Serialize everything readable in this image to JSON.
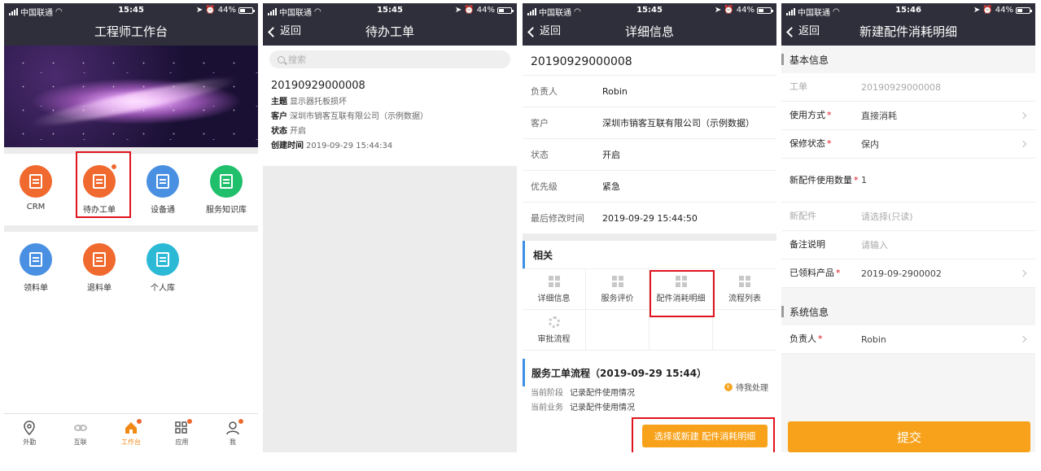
{
  "status_bar": {
    "carrier": "中国联通",
    "battery": "44%",
    "battery_level": 0.44,
    "times": [
      "15:45",
      "15:45",
      "15:45",
      "15:46"
    ]
  },
  "screen1": {
    "title": "工程师工作台",
    "apps_row1": [
      {
        "label": "CRM",
        "color": "#f0692e",
        "icon": "pie-chart-icon"
      },
      {
        "label": "待办工单",
        "color": "#f0692e",
        "icon": "todo-list-icon",
        "badge": true
      },
      {
        "label": "设备通",
        "color": "#4a90e2",
        "icon": "device-icon"
      },
      {
        "label": "服务知识库",
        "color": "#1fbf6c",
        "icon": "book-icon"
      }
    ],
    "apps_row2": [
      {
        "label": "领料单",
        "color": "#4a90e2",
        "icon": "clipboard-icon"
      },
      {
        "label": "退料单",
        "color": "#f0692e",
        "icon": "return-icon"
      },
      {
        "label": "个人库",
        "color": "#2cb9d6",
        "icon": "briefcase-icon"
      }
    ],
    "tabs": [
      {
        "label": "外勤",
        "icon": "location-icon"
      },
      {
        "label": "互联",
        "icon": "link-icon"
      },
      {
        "label": "工作台",
        "icon": "home-icon",
        "active": true,
        "badge": true
      },
      {
        "label": "应用",
        "icon": "apps-icon",
        "badge": true
      },
      {
        "label": "我",
        "icon": "person-icon",
        "badge": true
      }
    ]
  },
  "screen2": {
    "back": "返回",
    "title": "待办工单",
    "search_placeholder": "搜索",
    "order": {
      "number": "20190929000008",
      "subject_label": "主题",
      "subject": "显示器托板损坏",
      "customer_label": "客户",
      "customer": "深圳市销客互联有限公司（示例数据）",
      "status_label": "状态",
      "status": "开启",
      "created_label": "创建时间",
      "created": "2019-09-29 15:44:34"
    }
  },
  "screen3": {
    "back": "返回",
    "title": "详细信息",
    "number": "20190929000008",
    "rows": [
      {
        "label": "负责人",
        "value": "Robin"
      },
      {
        "label": "客户",
        "value": "深圳市销客互联有限公司（示例数据）"
      },
      {
        "label": "状态",
        "value": "开启"
      },
      {
        "label": "优先级",
        "value": "紧急"
      },
      {
        "label": "最后修改时间",
        "value": "2019-09-29 15:44:50"
      }
    ],
    "related_title": "相关",
    "related": [
      {
        "label": "详细信息",
        "icon": "grid-icon"
      },
      {
        "label": "服务评价",
        "icon": "grid-icon"
      },
      {
        "label": "配件消耗明细",
        "icon": "grid-icon"
      },
      {
        "label": "流程列表",
        "icon": "grid-icon"
      },
      {
        "label": "审批流程",
        "icon": "gear-icon"
      }
    ],
    "flow_title": "服务工单流程（2019-09-29 15:44）",
    "flow_status": "待我处理",
    "stage_label": "当前阶段",
    "stage_value": "记录配件使用情况",
    "business_label": "当前业务",
    "business_value": "记录配件使用情况",
    "action": "选择或新建 配件消耗明细"
  },
  "screen4": {
    "back": "返回",
    "title": "新建配件消耗明细",
    "basic_title": "基本信息",
    "fields": [
      {
        "label": "工单",
        "value": "20190929000008",
        "required": false,
        "readonly": true,
        "chevron": false
      },
      {
        "label": "使用方式",
        "value": "直接消耗",
        "required": true,
        "readonly": false,
        "chevron": true
      },
      {
        "label": "保修状态",
        "value": "保内",
        "required": true,
        "readonly": false,
        "chevron": true
      },
      {
        "label": "新配件使用数量",
        "value": "1",
        "required": true,
        "readonly": false,
        "chevron": false,
        "tall": true
      },
      {
        "label": "新配件",
        "value": "请选择(只读)",
        "required": false,
        "readonly": true,
        "chevron": false,
        "placeholder": true
      },
      {
        "label": "备注说明",
        "value": "请输入",
        "required": false,
        "readonly": false,
        "chevron": false,
        "placeholder": true
      },
      {
        "label": "已领料产品",
        "value": "2019-09-2900002",
        "required": true,
        "readonly": false,
        "chevron": true
      }
    ],
    "system_title": "系统信息",
    "owner_label": "负责人",
    "owner_value": "Robin",
    "submit": "提交"
  }
}
